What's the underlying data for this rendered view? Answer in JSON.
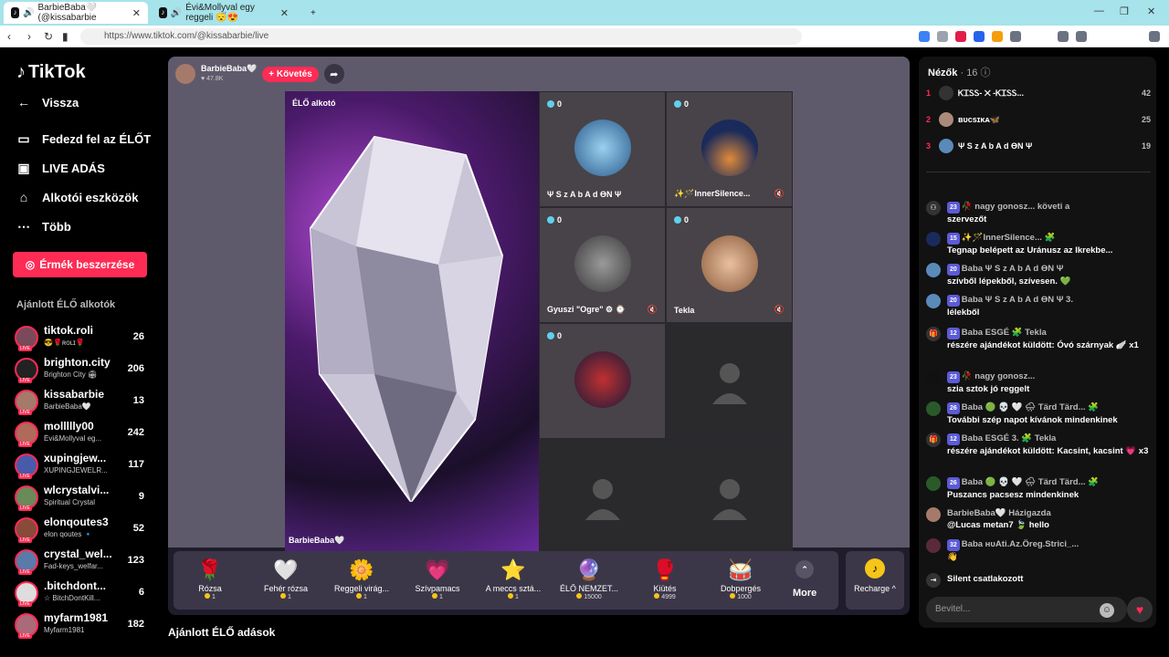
{
  "browser": {
    "tabs": [
      {
        "title": "BarbieBaba🤍 (@kissabarbie"
      },
      {
        "title": "Évi&Mollyval egy reggeli 😴😍"
      }
    ],
    "new_tab": "+",
    "url": "https://www.tiktok.com/@kissabarbie/live"
  },
  "sidebar": {
    "logo": "TikTok",
    "back": "Vissza",
    "menu": [
      {
        "label": "Fedezd fel az ÉLŐT",
        "icon": "explore-icon"
      },
      {
        "label": "LIVE ADÁS",
        "icon": "camera-icon"
      },
      {
        "label": "Alkotói eszközök",
        "icon": "home-icon"
      },
      {
        "label": "Több",
        "icon": "more-icon"
      }
    ],
    "coins_button": "Érmék beszerzése",
    "section_title": "Ajánlott ÉLŐ alkotók",
    "creators": [
      {
        "name": "tiktok.roli",
        "sub": "😎🌹ʀᴏʟɪ🌹",
        "count": "26"
      },
      {
        "name": "brighton.city",
        "sub": "Brighton City 🏟",
        "count": "206"
      },
      {
        "name": "kissabarbie",
        "sub": "BarbieBaba🤍",
        "count": "13"
      },
      {
        "name": "mollllly00",
        "sub": "Évi&Mollyval eg...",
        "count": "242"
      },
      {
        "name": "xupingjew...",
        "sub": "XUPINGJEWELR...",
        "count": "117"
      },
      {
        "name": "wlcrystalvi...",
        "sub": "Spiritual Crystal",
        "count": "9"
      },
      {
        "name": "elonqoutes3",
        "sub": "elon qoutes 🔹",
        "count": "52"
      },
      {
        "name": "crystal_wel...",
        "sub": "Fad-keys_welfar...",
        "count": "123"
      },
      {
        "name": ".bitchdont...",
        "sub": "☆ BitchDontKill...",
        "count": "6"
      },
      {
        "name": "myfarm1981",
        "sub": "Myfarm1981",
        "count": "182"
      }
    ]
  },
  "stream": {
    "host_name": "BarbieBaba🤍",
    "host_likes": "♥ 47.8K",
    "follow": "+ Követés",
    "video_label": "ÉLŐ alkotó",
    "video_owner": "BarbieBaba🤍",
    "guests": [
      {
        "count": "0",
        "name": "Ψ S z A b A d ӨN Ψ",
        "muted": false
      },
      {
        "count": "0",
        "name": "✨🪄InnerSilence...",
        "muted": true
      },
      {
        "count": "0",
        "name": "Gyuszi \"Ogre\" ⚙ ⌚",
        "muted": true
      },
      {
        "count": "0",
        "name": "Tekla",
        "muted": true
      },
      {
        "count": "0",
        "name": "",
        "muted": false
      }
    ],
    "mute_icon": "🔇"
  },
  "gifts": [
    {
      "name": "Rózsa",
      "price": "1",
      "icon": "🌹"
    },
    {
      "name": "Fehér rózsa",
      "price": "1",
      "icon": "🤍"
    },
    {
      "name": "Reggeli virág...",
      "price": "1",
      "icon": "🌼"
    },
    {
      "name": "Szívpamacs",
      "price": "1",
      "icon": "💗"
    },
    {
      "name": "A meccs sztá...",
      "price": "1",
      "icon": "⭐"
    },
    {
      "name": "ÉLŐ NEMZET...",
      "price": "15000",
      "icon": "🔮"
    },
    {
      "name": "Kiütés",
      "price": "4999",
      "icon": "🥊"
    },
    {
      "name": "Dobpergés",
      "price": "1000",
      "icon": "🥁"
    }
  ],
  "more_label": "More",
  "recharge_label": "Recharge ^",
  "recommended_title": "Ajánlott ÉLŐ adások",
  "chat": {
    "viewers_title": "Nézők",
    "viewers_count": "· 16",
    "top_viewers": [
      {
        "rank": "1",
        "name": "ᏦᏆᏚᏚ- ✕ -ᏦᏆᏚᏚ...",
        "score": "42"
      },
      {
        "rank": "2",
        "name": "ʙᴜᴄsɪᴋᴀ🦋",
        "score": "25"
      },
      {
        "rank": "3",
        "name": "Ψ S z A b A d ӨN Ψ",
        "score": "19"
      }
    ],
    "messages": [
      {
        "level": "23",
        "head": "🥀 nagy gonosz... követi a",
        "text": "szervezőt"
      },
      {
        "level": "15",
        "head": "✨🪄InnerSilence... 🧩",
        "text": "Tegnap belépett az Uránusz az Ikrekbe..."
      },
      {
        "level": "20",
        "head": "Baba Ψ S z A b A d ӨN Ψ",
        "text": "szívből lépekből, szívesen. 💚"
      },
      {
        "level": "20",
        "head": "Baba Ψ S z A b A d ӨN Ψ 3.",
        "text": "lélekből"
      },
      {
        "level": "12",
        "head": "Baba ESGÉ 🧩 Tekla",
        "text": "részére ajándékot küldött: Óvó szárnyak 🪽 x1"
      },
      {
        "level": "23",
        "head": "🥀 nagy gonosz...",
        "text": "szia sztok jó reggelt"
      },
      {
        "level": "26",
        "head": "Baba 🟢 💀 🤍 🌧 Tärd Tärd... 🧩",
        "text": "További szép napot kívánok mindenkinek"
      },
      {
        "level": "12",
        "head": "Baba ESGÉ 3. 🧩 Tekla",
        "text": "részére ajándékot küldött: Kacsint, kacsint 💗 x3"
      },
      {
        "level": "26",
        "head": "Baba 🟢 💀 🤍 🌧 Tärd Tärd... 🧩",
        "text": "Puszancs pacsesz mindenkinek"
      },
      {
        "level": "",
        "head": "BarbieBaba🤍 Házigazda",
        "text": "@Lucas metan7 🍃 hello"
      },
      {
        "level": "32",
        "head": "Baba нᴜAti.Az.Öreg.Strici_...",
        "text": "👋"
      },
      {
        "level": "",
        "head": "",
        "text": "Silent  csatlakozott"
      }
    ],
    "input_placeholder": "Bevitel..."
  }
}
